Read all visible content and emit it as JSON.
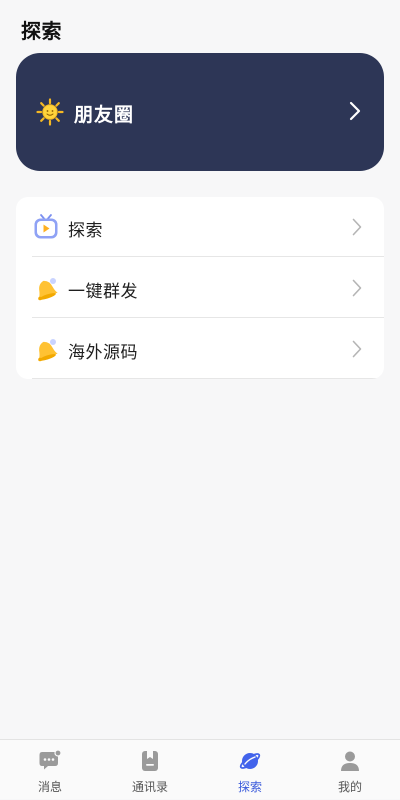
{
  "header": {
    "title": "探索"
  },
  "moments": {
    "label": "朋友圈",
    "icon": "sun-icon"
  },
  "list": {
    "items": [
      {
        "label": "探索",
        "icon": "tv-play-icon"
      },
      {
        "label": "一键群发",
        "icon": "bell-icon"
      },
      {
        "label": "海外源码",
        "icon": "bell-icon"
      }
    ]
  },
  "tabbar": {
    "tabs": [
      {
        "label": "消息",
        "icon": "chat-icon",
        "active": false
      },
      {
        "label": "通讯录",
        "icon": "contacts-icon",
        "active": false
      },
      {
        "label": "探索",
        "icon": "planet-icon",
        "active": true
      },
      {
        "label": "我的",
        "icon": "person-icon",
        "active": false
      }
    ]
  },
  "colors": {
    "card_background": "#2d3656",
    "active_tab": "#3b5bdb"
  }
}
